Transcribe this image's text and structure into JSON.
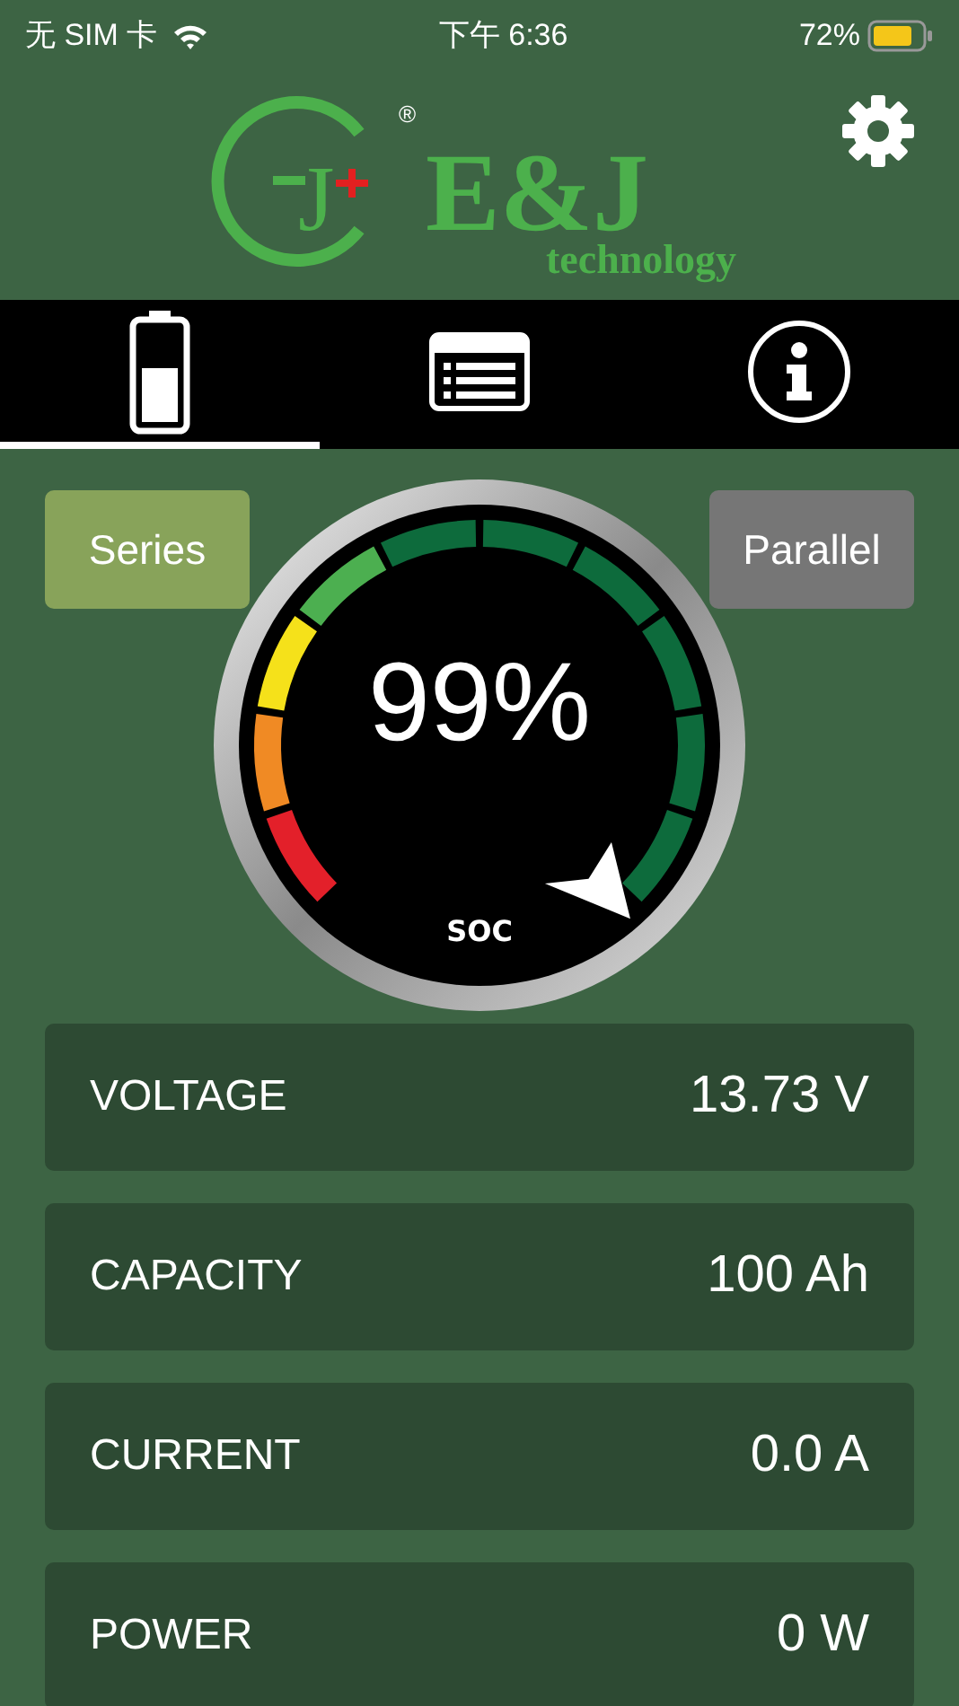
{
  "status_bar": {
    "carrier": "无 SIM 卡",
    "time": "下午 6:36",
    "battery": "72%"
  },
  "header": {
    "logo_mark": "J",
    "logo_name": "E&J",
    "logo_registered": "®",
    "logo_tagline": "technology"
  },
  "tabs": [
    {
      "kind": "battery",
      "selected": true
    },
    {
      "kind": "list",
      "selected": false
    },
    {
      "kind": "info",
      "selected": false
    }
  ],
  "modes": [
    {
      "label": "Series",
      "selected": true
    },
    {
      "label": "Parallel",
      "selected": false
    }
  ],
  "gauge": {
    "reading": "99%",
    "label": "SOC"
  },
  "readings": [
    {
      "name": "VOLTAGE",
      "value": "13.73 V"
    },
    {
      "name": "CAPACITY",
      "value": "100 Ah"
    },
    {
      "name": "CURRENT",
      "value": "0.0 A"
    },
    {
      "name": "POWER",
      "value": "0 W"
    }
  ]
}
